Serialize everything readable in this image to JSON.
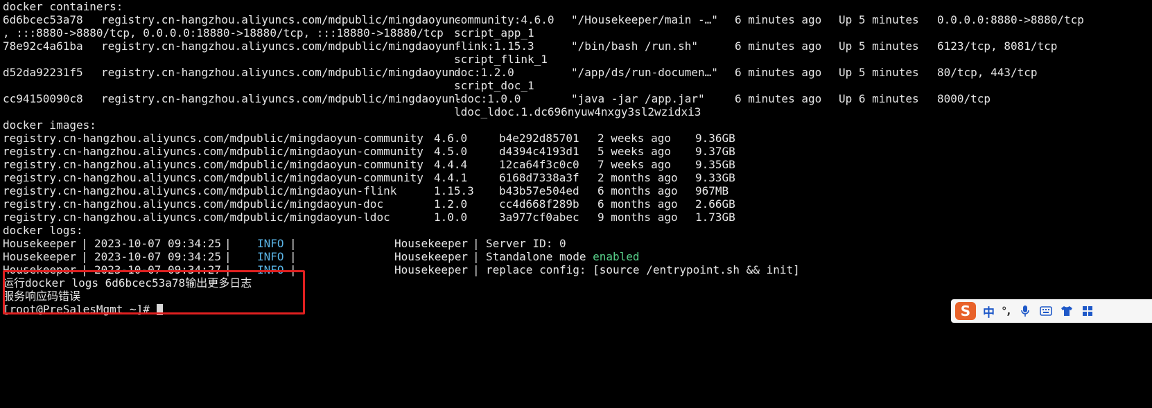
{
  "terminal": {
    "containers_header": "docker containers:",
    "containers": [
      {
        "id": "6d6bcec53a78",
        "image_prefix": "registry.cn-hangzhou.aliyuncs.com/mdpublic/mingdaoyun-",
        "image_suffix": "community:4.6.0",
        "command": "\"/Housekeeper/main -…\"",
        "created": "6 minutes ago",
        "status": "Up 5 minutes",
        "ports": "0.0.0.0:8880->8880/tcp",
        "ports_cont": ", :::8880->8880/tcp, 0.0.0.0:18880->18880/tcp, :::18880->18880/tcp",
        "name": "script_app_1"
      },
      {
        "id": "78e92c4a61ba",
        "image_prefix": "registry.cn-hangzhou.aliyuncs.com/mdpublic/mingdaoyun-",
        "image_suffix": "flink:1.15.3",
        "command": "\"/bin/bash /run.sh\"",
        "created": "6 minutes ago",
        "status": "Up 5 minutes",
        "ports": "6123/tcp, 8081/tcp",
        "name": "script_flink_1"
      },
      {
        "id": "d52da92231f5",
        "image_prefix": "registry.cn-hangzhou.aliyuncs.com/mdpublic/mingdaoyun-",
        "image_suffix": "doc:1.2.0",
        "command": "\"/app/ds/run-documen…\"",
        "created": "6 minutes ago",
        "status": "Up 5 minutes",
        "ports": "80/tcp, 443/tcp",
        "name": "script_doc_1"
      },
      {
        "id": "cc94150090c8",
        "image_prefix": "registry.cn-hangzhou.aliyuncs.com/mdpublic/mingdaoyun-",
        "image_suffix": "ldoc:1.0.0",
        "command": "\"java -jar /app.jar\"",
        "created": "6 minutes ago",
        "status": "Up 6 minutes",
        "ports": "8000/tcp",
        "name": "ldoc_ldoc.1.dc696nyuw4nxgy3sl2wzidxi3"
      }
    ],
    "images_header": "docker images:",
    "images": [
      {
        "repo": "registry.cn-hangzhou.aliyuncs.com/mdpublic/mingdaoyun-community",
        "tag": "4.6.0",
        "id": "b4e292d85701",
        "created": "2 weeks ago",
        "size": "9.36GB"
      },
      {
        "repo": "registry.cn-hangzhou.aliyuncs.com/mdpublic/mingdaoyun-community",
        "tag": "4.5.0",
        "id": "d4394c4193d1",
        "created": "5 weeks ago",
        "size": "9.37GB"
      },
      {
        "repo": "registry.cn-hangzhou.aliyuncs.com/mdpublic/mingdaoyun-community",
        "tag": "4.4.4",
        "id": "12ca64f3c0c0",
        "created": "7 weeks ago",
        "size": "9.35GB"
      },
      {
        "repo": "registry.cn-hangzhou.aliyuncs.com/mdpublic/mingdaoyun-community",
        "tag": "4.4.1",
        "id": "6168d7338a3f",
        "created": "2 months ago",
        "size": "9.33GB"
      },
      {
        "repo": "registry.cn-hangzhou.aliyuncs.com/mdpublic/mingdaoyun-flink",
        "tag": "1.15.3",
        "id": "b43b57e504ed",
        "created": "6 months ago",
        "size": "967MB"
      },
      {
        "repo": "registry.cn-hangzhou.aliyuncs.com/mdpublic/mingdaoyun-doc",
        "tag": "1.2.0",
        "id": "cc4d668f289b",
        "created": "6 months ago",
        "size": "2.66GB"
      },
      {
        "repo": "registry.cn-hangzhou.aliyuncs.com/mdpublic/mingdaoyun-ldoc",
        "tag": "1.0.0",
        "id": "3a977cf0abec",
        "created": "9 months ago",
        "size": "1.73GB"
      }
    ],
    "logs_header": "docker logs:",
    "logs": [
      {
        "service": "Housekeeper",
        "sep": "|",
        "timestamp": "2023-10-07 09:34:25",
        "level": "INFO",
        "service2": "Housekeeper",
        "message": "Server ID: 0",
        "highlight": ""
      },
      {
        "service": "Housekeeper",
        "sep": "|",
        "timestamp": "2023-10-07 09:34:25",
        "level": "INFO",
        "service2": "Housekeeper",
        "message": "Standalone mode ",
        "highlight": "enabled"
      },
      {
        "service": "Housekeeper",
        "sep": "|",
        "timestamp": "2023-10-07 09:34:27",
        "level": "INFO",
        "service2": "Housekeeper",
        "message": "replace config: [source /entrypoint.sh && init]",
        "highlight": ""
      }
    ],
    "hint_line": "运行docker logs 6d6bcec53a78输出更多日志",
    "error_line": "服务响应码错误",
    "prompt": "[root@PreSalesMgmt ~]# "
  },
  "ime": {
    "logo": "S",
    "mode": "中",
    "punct": "°,"
  },
  "colors": {
    "background": "#000000",
    "foreground": "#e6e6e6",
    "info": "#5ab4e6",
    "enabled": "#58d08a",
    "annotation_box": "#e02020"
  }
}
